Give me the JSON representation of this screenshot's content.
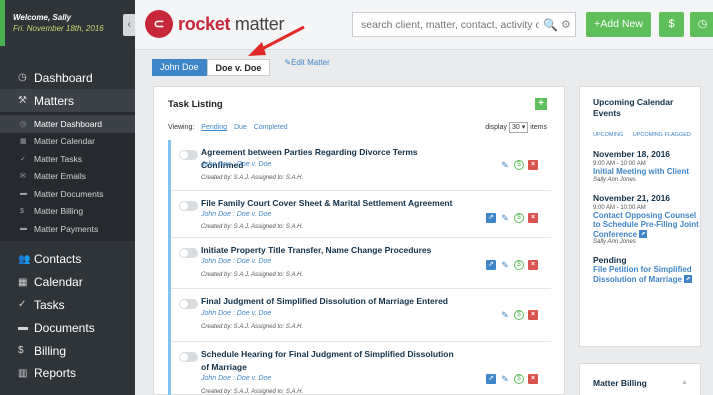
{
  "sidebar": {
    "welcome": "Welcome, Sally",
    "date": "Fri. November 18th, 2016",
    "collapse": "‹",
    "top_items": [
      {
        "label": "Dashboard",
        "icon": "◷"
      },
      {
        "label": "Matters",
        "icon": "⚒"
      }
    ],
    "sub_items": [
      {
        "label": "Matter Dashboard",
        "icon": "◷"
      },
      {
        "label": "Matter Calendar",
        "icon": "▦"
      },
      {
        "label": "Matter Tasks",
        "icon": "✓"
      },
      {
        "label": "Matter Emails",
        "icon": "✉"
      },
      {
        "label": "Matter Documents",
        "icon": "▬"
      },
      {
        "label": "Matter Billing",
        "icon": "$"
      },
      {
        "label": "Matter Payments",
        "icon": "▬"
      }
    ],
    "bottom_items": [
      {
        "label": "Contacts",
        "icon": "👥"
      },
      {
        "label": "Calendar",
        "icon": "▦"
      },
      {
        "label": "Tasks",
        "icon": "✓"
      },
      {
        "label": "Documents",
        "icon": "▬"
      },
      {
        "label": "Billing",
        "icon": "$"
      },
      {
        "label": "Reports",
        "icon": "▥"
      }
    ]
  },
  "header": {
    "logo_icon": "⊂",
    "logo_text_bold": "rocket",
    "logo_text_light": " matter",
    "search_placeholder": "search client, matter, contact, activity or tag",
    "search_icon": "🔍",
    "gear_icon": "⚙",
    "add_new_label": "+Add New",
    "billing_icon": "$",
    "timer_icon": "◷"
  },
  "matter_nav": {
    "client": "John Doe",
    "matter": "Doe v. Doe",
    "edit_label": "✎Edit Matter"
  },
  "task_listing": {
    "title": "Task Listing",
    "add": "+",
    "viewing_label": "Viewing:",
    "filters": [
      "Pending",
      "Due",
      "Completed"
    ],
    "display_label": "display",
    "display_value": "30 ▾",
    "items_label": "items",
    "tasks": [
      {
        "title": "Agreement between Parties Regarding Divorce Terms Confirmed",
        "matter": "John Doe : Doe v. Doe",
        "meta": "Created by: S.A.J. Assigned to: S.A.H."
      },
      {
        "title": "File Family Court Cover Sheet & Marital Settlement Agreement",
        "matter": "John Doe : Doe v. Doe",
        "meta": "Created by: S.A.J. Assigned to: S.A.H."
      },
      {
        "title": "Initiate Property Title Transfer, Name Change Procedures",
        "matter": "John Doe : Doe v. Doe",
        "meta": "Created by: S.A.J. Assigned to: S.A.H."
      },
      {
        "title": "Final Judgment of Simplified Dissolution of Marriage Entered",
        "matter": "John Doe : Doe v. Doe",
        "meta": "Created by: S.A.J. Assigned to: S.A.H."
      },
      {
        "title": "Schedule Hearing for Final Judgment of Simplified Dissolution of Marriage",
        "matter": "John Doe : Doe v. Doe",
        "meta": "Created by: S.A.J. Assigned to: S.A.H."
      }
    ]
  },
  "calendar_panel": {
    "title": "Upcoming Calendar Events",
    "filter1": "UPCOMING",
    "filter2": "UPCOMING FLAGGED",
    "groups": [
      {
        "date": "November 18, 2016",
        "time": "9:00 AM - 10:00 AM",
        "event": "Initial Meeting with Client",
        "who": "Sally Ann Jones"
      },
      {
        "date": "November 21, 2016",
        "time": "9:00 AM - 10:00 AM",
        "event": "Contact Opposing Counsel to Schedule Pre-Filing Joint Conference",
        "who": "Sally Ann Jones"
      },
      {
        "date": "Pending",
        "time": "",
        "event": "File Petition for Simplified Dissolution of Marriage",
        "who": ""
      }
    ]
  },
  "billing_panel": {
    "title": "Matter Billing",
    "caret": "▲"
  },
  "colors": {
    "sidebar_bg": "#2f3439",
    "accent_green": "#5fbf5b",
    "accent_blue": "#3f86c8",
    "brand_red": "#c8273a",
    "annotation_arrow": "#e02a2a"
  }
}
